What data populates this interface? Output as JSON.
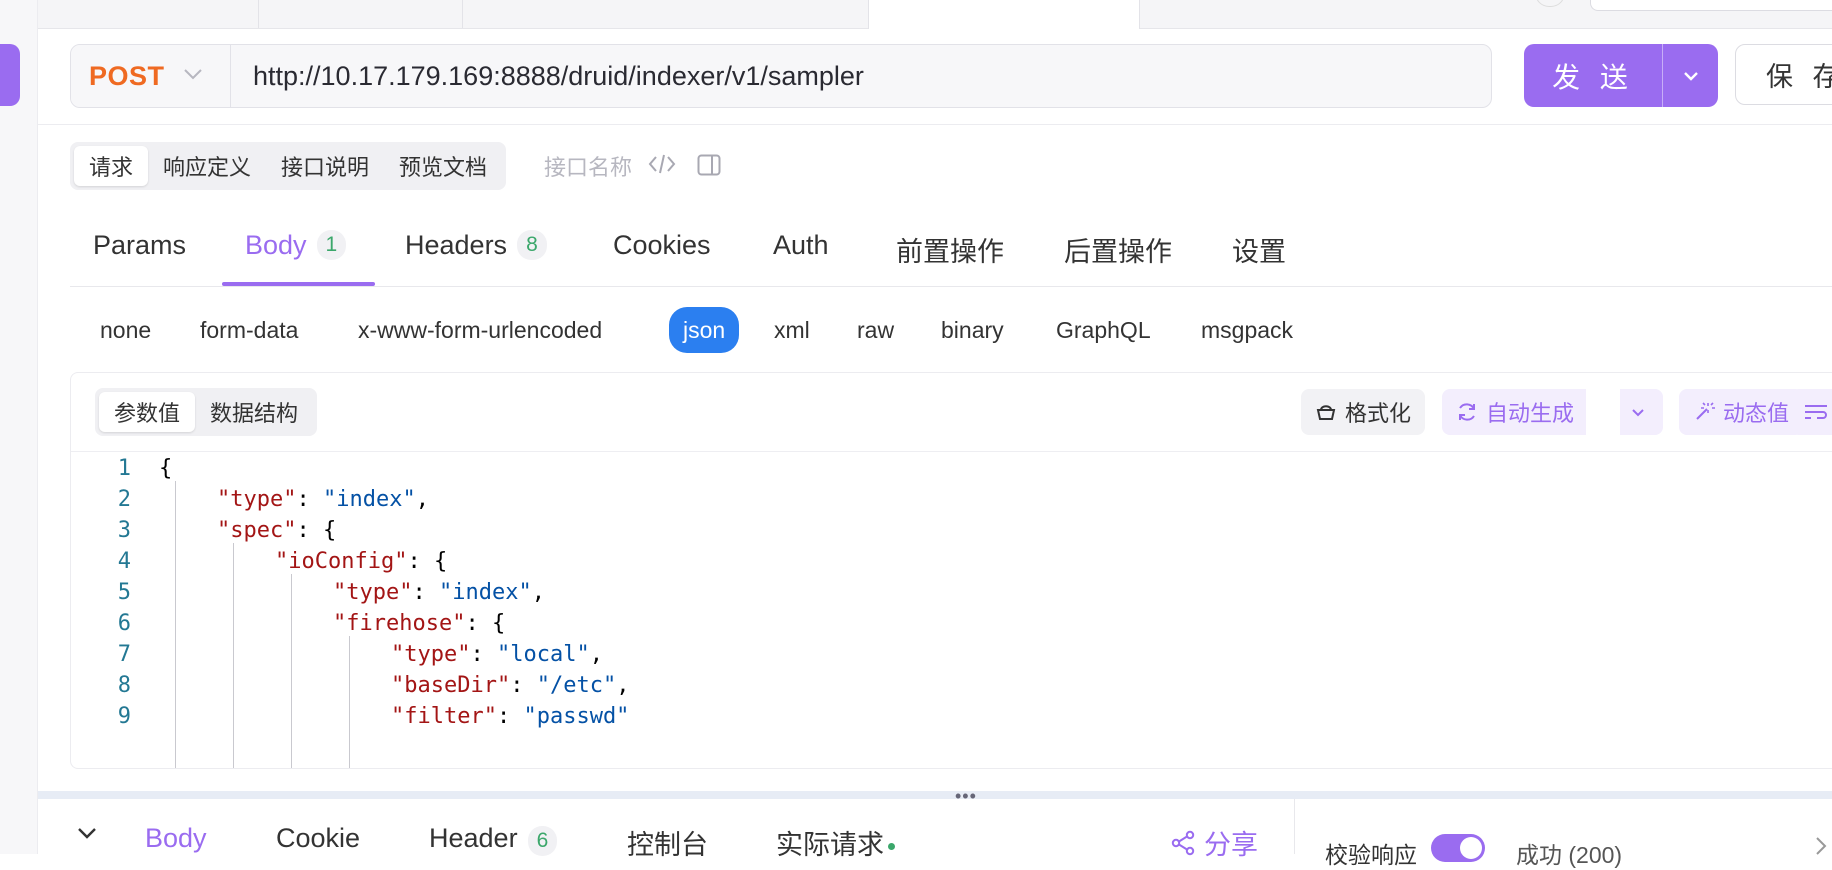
{
  "request": {
    "method": "POST",
    "url": "http://10.17.179.169:8888/druid/indexer/v1/sampler",
    "send_label": "发 送",
    "save_label": "保 存"
  },
  "segment_tabs": [
    "请求",
    "响应定义",
    "接口说明",
    "预览文档"
  ],
  "api_name_placeholder": "接口名称",
  "request_tabs": [
    {
      "label": "Params"
    },
    {
      "label": "Body",
      "badge": "1"
    },
    {
      "label": "Headers",
      "badge": "8"
    },
    {
      "label": "Cookies"
    },
    {
      "label": "Auth"
    },
    {
      "label": "前置操作"
    },
    {
      "label": "后置操作"
    },
    {
      "label": "设置"
    }
  ],
  "body_types": [
    "none",
    "form-data",
    "x-www-form-urlencoded",
    "json",
    "xml",
    "raw",
    "binary",
    "GraphQL",
    "msgpack"
  ],
  "body_type_selected": "json",
  "editor": {
    "mode_tabs": [
      "参数值",
      "数据结构"
    ],
    "format_label": "格式化",
    "autogen_label": "自动生成",
    "dynamic_label": "动态值",
    "lines": [
      {
        "n": "1",
        "parts": [
          [
            "p",
            "{"
          ]
        ]
      },
      {
        "n": "2",
        "parts": [
          [
            "k",
            "\"type\""
          ],
          [
            "p",
            ": "
          ],
          [
            "s",
            "\"index\""
          ],
          [
            "p",
            ","
          ]
        ]
      },
      {
        "n": "3",
        "parts": [
          [
            "k",
            "\"spec\""
          ],
          [
            "p",
            ": {"
          ]
        ]
      },
      {
        "n": "4",
        "parts": [
          [
            "k",
            "\"ioConfig\""
          ],
          [
            "p",
            ": {"
          ]
        ]
      },
      {
        "n": "5",
        "parts": [
          [
            "k",
            "\"type\""
          ],
          [
            "p",
            ": "
          ],
          [
            "s",
            "\"index\""
          ],
          [
            "p",
            ","
          ]
        ]
      },
      {
        "n": "6",
        "parts": [
          [
            "k",
            "\"firehose\""
          ],
          [
            "p",
            ": {"
          ]
        ]
      },
      {
        "n": "7",
        "parts": [
          [
            "k",
            "\"type\""
          ],
          [
            "p",
            ": "
          ],
          [
            "s",
            "\"local\""
          ],
          [
            "p",
            ","
          ]
        ]
      },
      {
        "n": "8",
        "parts": [
          [
            "k",
            "\"baseDir\""
          ],
          [
            "p",
            ": "
          ],
          [
            "s",
            "\"/etc\""
          ],
          [
            "p",
            ","
          ]
        ]
      },
      {
        "n": "9",
        "parts": [
          [
            "k",
            "\"filter\""
          ],
          [
            "p",
            ": "
          ],
          [
            "s",
            "\"passwd\""
          ]
        ]
      }
    ]
  },
  "response": {
    "tabs": [
      {
        "label": "Body"
      },
      {
        "label": "Cookie"
      },
      {
        "label": "Header",
        "badge": "6"
      },
      {
        "label": "控制台"
      },
      {
        "label": "实际请求"
      }
    ],
    "share_label": "分享",
    "validate_label": "校验响应",
    "success_label": "成功 (200)"
  },
  "colors": {
    "accent": "#9a6cf0",
    "method": "#ef6a22",
    "json_selected": "#2b7ff0",
    "json_key": "#a31515",
    "json_string": "#0451a5",
    "badge_green": "#3ba76b"
  }
}
